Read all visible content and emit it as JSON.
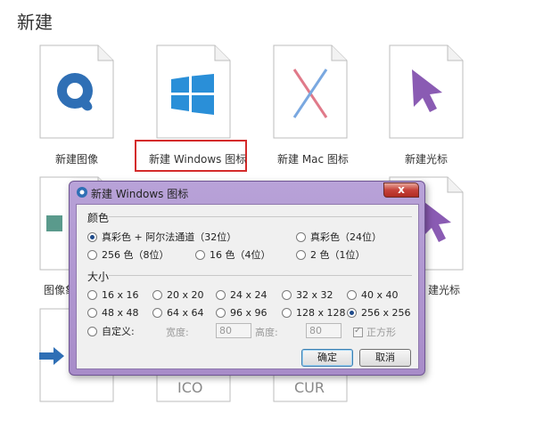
{
  "page": {
    "title": "新建"
  },
  "cards": [
    {
      "label": "新建图像",
      "icon": "app-logo-icon"
    },
    {
      "label": "新建 Windows 图标",
      "icon": "windows-logo-icon"
    },
    {
      "label": "新建 Mac 图标",
      "icon": "mac-x-icon"
    },
    {
      "label": "新建光标",
      "icon": "cursor-arrow-icon"
    },
    {
      "label": "图像象",
      "icon": "image-icon"
    },
    {
      "label": "建光标",
      "icon": "cursor-arrow-icon"
    },
    {
      "label": "ICO",
      "icon": "ico-text"
    },
    {
      "label": "CUR",
      "icon": "cur-text"
    }
  ],
  "dialog": {
    "title": "新建 Windows 图标",
    "close_label": "x",
    "color_group": {
      "label": "颜色",
      "options": [
        {
          "label": "真彩色 + 阿尔法通道（32位）",
          "selected": true
        },
        {
          "label": "真彩色（24位）",
          "selected": false
        },
        {
          "label": "256 色（8位）",
          "selected": false
        },
        {
          "label": "16 色（4位）",
          "selected": false
        },
        {
          "label": "2 色（1位）",
          "selected": false
        }
      ]
    },
    "size_group": {
      "label": "大小",
      "options": [
        {
          "label": "16 x 16",
          "selected": false
        },
        {
          "label": "20 x 20",
          "selected": false
        },
        {
          "label": "24 x 24",
          "selected": false
        },
        {
          "label": "32 x 32",
          "selected": false
        },
        {
          "label": "40 x 40",
          "selected": false
        },
        {
          "label": "48 x 48",
          "selected": false
        },
        {
          "label": "64 x 64",
          "selected": false
        },
        {
          "label": "96 x 96",
          "selected": false
        },
        {
          "label": "128 x 128",
          "selected": false
        },
        {
          "label": "256 x 256",
          "selected": true
        }
      ],
      "custom": {
        "label": "自定义:",
        "width_label": "宽度:",
        "width_value": "80",
        "height_label": "高度:",
        "height_value": "80",
        "square_label": "正方形",
        "square_checked": true
      }
    },
    "ok_label": "确定",
    "cancel_label": "取消"
  },
  "colors": {
    "highlight": "#d42b2b",
    "windows_blue": "#2a8fd8",
    "cursor_purple": "#8a5bb3",
    "dialog_frame": "#a88cc9"
  }
}
